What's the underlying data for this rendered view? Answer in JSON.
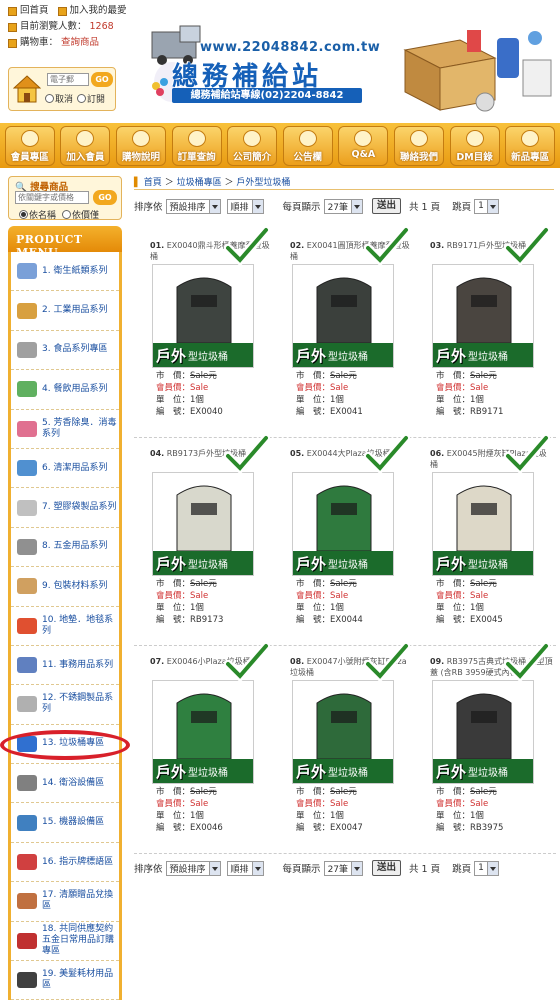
{
  "header": {
    "home_link": "回首頁",
    "favorite_link": "加入我的最愛",
    "visitors_label": "目前瀏覽人數：",
    "visitors_count": "1268",
    "cart_label": "購物車：",
    "cart_link": "查詢商品",
    "login_placeholder": "電子郵",
    "login_go": "GO",
    "login_opt_cancel": "取消",
    "login_opt_subscribe": "訂閱",
    "site_url": "www.22048842.com.tw",
    "site_name": "總務補給站",
    "hotline": "總務補給站專線(02)2204-8842"
  },
  "nav": [
    {
      "label": "會員專區",
      "icon": "home-icon"
    },
    {
      "label": "加入會員",
      "icon": "crown-icon"
    },
    {
      "label": "購物說明",
      "icon": "document-icon"
    },
    {
      "label": "訂單查詢",
      "icon": "list-icon"
    },
    {
      "label": "公司簡介",
      "icon": "company-icon"
    },
    {
      "label": "公告欄",
      "icon": "board-icon"
    },
    {
      "label": "Q&A",
      "icon": "chat-icon"
    },
    {
      "label": "聯絡我們",
      "icon": "phone-icon"
    },
    {
      "label": "DM目錄",
      "icon": "book-icon"
    },
    {
      "label": "新品專區",
      "icon": "new-icon"
    }
  ],
  "search": {
    "title": "搜尋商品",
    "placeholder": "依關鍵字或價格",
    "go": "GO",
    "opt_name": "依名稱",
    "opt_price": "依價僅"
  },
  "menu": {
    "title": "PRODUCT MENU",
    "items": [
      "1. 衛生紙類系列",
      "2. 工業用品系列",
      "3. 食品系列專區",
      "4. 餐飲用品系列",
      "5. 芳香除臭．消毒系列",
      "6. 清潔用品系列",
      "7. 塑膠袋製品系列",
      "8. 五金用品系列",
      "9. 包裝材料系列",
      "10. 地墊．地毯系列",
      "11. 事務用品系列",
      "12. 不銹鋼製品系列",
      "13. 垃圾桶專區",
      "14. 衛浴設備區",
      "15. 機器設備區",
      "16. 指示牌標語區",
      "17. 清願贈品兌換區",
      "18. 共同供應契約五金日常用品訂購專區",
      "19. 美髮耗材用品區"
    ]
  },
  "breadcrumb": {
    "home": "首頁",
    "category": "垃圾桶專區",
    "current": "戶外型垃圾桶",
    "sep": "＞"
  },
  "toolbar": {
    "sort_label": "排序依",
    "sort_value": "預設排序",
    "order_value": "順排",
    "per_page_label": "每頁顯示",
    "per_page_value": "27筆",
    "send": "送出",
    "total_pages": "共 1 頁",
    "jump_label": "跳頁",
    "page_value": "1"
  },
  "badge": {
    "big": "戶外",
    "small": "型垃圾桶"
  },
  "labels": {
    "market_price": "市　價：",
    "member_price": "會員價：",
    "unit": "單　位：",
    "code": "編　號："
  },
  "products": [
    {
      "no": "01.",
      "name": "EX0040鼎斗形桶蓋摩登垃圾桶",
      "market": "Sale元",
      "member": "Sale",
      "unit": "1個",
      "code": "EX0040",
      "color": "#3e4440"
    },
    {
      "no": "02.",
      "name": "EX0041圓頂形桶蓋摩登垃圾桶",
      "market": "Sale元",
      "member": "Sale",
      "unit": "1個",
      "code": "EX0041",
      "color": "#3b403c"
    },
    {
      "no": "03.",
      "name": "RB9171戶外型垃圾桶",
      "market": "Sale元",
      "member": "Sale",
      "unit": "1個",
      "code": "RB9171",
      "color": "#4a4540"
    },
    {
      "no": "04.",
      "name": "RB9173戶外型垃圾桶",
      "market": "Sale元",
      "member": "Sale",
      "unit": "1個",
      "code": "RB9173",
      "color": "#d8d8cc"
    },
    {
      "no": "05.",
      "name": "EX0044大Plaza垃圾桶",
      "market": "Sale元",
      "member": "Sale",
      "unit": "1個",
      "code": "EX0044",
      "color": "#2f7a3e"
    },
    {
      "no": "06.",
      "name": "EX0045附煙灰缸Plaza垃圾桶",
      "market": "Sale元",
      "member": "Sale",
      "unit": "1個",
      "code": "EX0045",
      "color": "#ddd8c8"
    },
    {
      "no": "07.",
      "name": "EX0046小Plaza垃圾桶",
      "market": "Sale元",
      "member": "Sale",
      "unit": "1個",
      "code": "EX0046",
      "color": "#2f8040"
    },
    {
      "no": "08.",
      "name": "EX0047小號附煙灰缸Plaza垃圾桶",
      "market": "Sale元",
      "member": "Sale",
      "unit": "1個",
      "code": "EX0047",
      "color": "#2e6a3a"
    },
    {
      "no": "09.",
      "name": "RB3975古典式垃圾桶 款型頂蓋 (含RB 3959硬式內桶)",
      "market": "Sale元",
      "member": "Sale",
      "unit": "1個",
      "code": "RB3975",
      "color": "#3a3a3a"
    }
  ]
}
